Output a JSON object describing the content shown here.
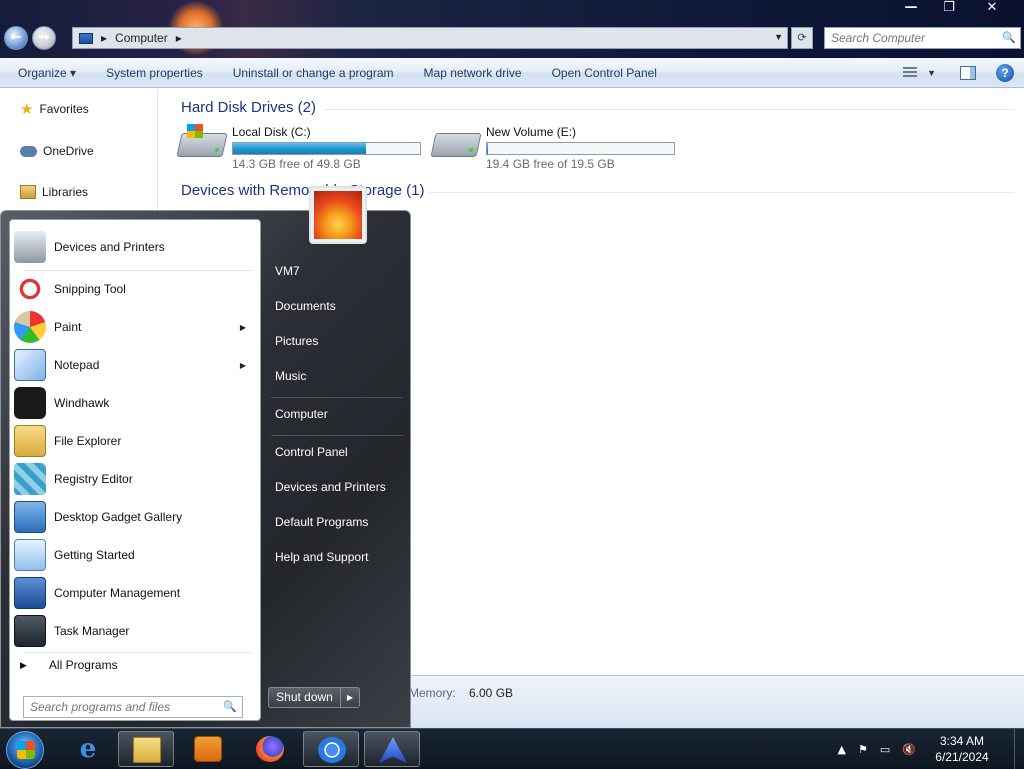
{
  "window": {
    "caption": {
      "minimize": "—",
      "restore": "❐",
      "close": "✕"
    },
    "nav": {
      "back": "←",
      "forward": "→"
    },
    "address": {
      "crumb": "Computer",
      "sep": "▸",
      "dropdown": "▼"
    },
    "search_placeholder": "Search Computer",
    "toolbar": {
      "items": [
        "Organize ▾",
        "System properties",
        "Uninstall or change a program",
        "Map network drive",
        "Open Control Panel"
      ],
      "views_dropdown": "▼",
      "help": "?"
    },
    "navpane": {
      "items": [
        "Favorites",
        "OneDrive",
        "Libraries"
      ]
    },
    "groups": {
      "hdd": "Hard Disk Drives (2)",
      "removable": "Devices with Removable Storage (1)"
    },
    "drives": [
      {
        "name": "Local Disk (C:)",
        "free": "14.3 GB free of 49.8 GB",
        "used_fraction": 0.713
      },
      {
        "name": "New Volume (E:)",
        "free": "19.4 GB free of 19.5 GB",
        "used_fraction": 0.005
      }
    ],
    "details": {
      "memory_label": "Memory:",
      "memory_value": "6.00 GB"
    }
  },
  "startmenu": {
    "programs": [
      {
        "label": "Devices and Printers",
        "icon": "printer-icon",
        "arrow": ""
      },
      {
        "label": "Snipping Tool",
        "icon": "scissors-icon",
        "arrow": ""
      },
      {
        "label": "Paint",
        "icon": "palette-icon",
        "arrow": "▶"
      },
      {
        "label": "Notepad",
        "icon": "notepad-icon",
        "arrow": "▶"
      },
      {
        "label": "Windhawk",
        "icon": "hawk-icon",
        "arrow": ""
      },
      {
        "label": "File Explorer",
        "icon": "folder-icon",
        "arrow": ""
      },
      {
        "label": "Registry Editor",
        "icon": "registry-icon",
        "arrow": ""
      },
      {
        "label": "Desktop Gadget Gallery",
        "icon": "gadget-icon",
        "arrow": ""
      },
      {
        "label": "Getting Started",
        "icon": "getting-started-icon",
        "arrow": ""
      },
      {
        "label": "Computer Management",
        "icon": "computer-management-icon",
        "arrow": ""
      },
      {
        "label": "Task Manager",
        "icon": "task-manager-icon",
        "arrow": ""
      }
    ],
    "all_programs": "All Programs",
    "all_programs_arrow": "▶",
    "search_placeholder": "Search programs and files",
    "right_links": [
      "VM7",
      "Documents",
      "Pictures",
      "Music",
      "Computer",
      "Control Panel",
      "Devices and Printers",
      "Default Programs",
      "Help and Support"
    ],
    "shutdown": "Shut down",
    "shutdown_arrow": "▶"
  },
  "taskbar": {
    "tray": {
      "show_hidden": "▲",
      "flag": "⚑",
      "network": "▭",
      "volume": "🔇"
    },
    "clock": {
      "time": "3:34 AM",
      "date": "6/21/2024"
    }
  }
}
